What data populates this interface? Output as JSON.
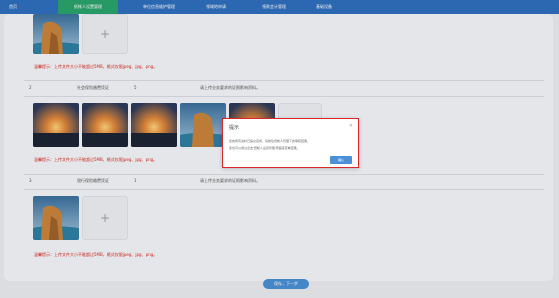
{
  "nav": {
    "items": [
      {
        "label": "首页",
        "active": false
      },
      {
        "label": "纸帐人设置管理",
        "active": true
      },
      {
        "label": "单位信息维护管理",
        "active": false
      },
      {
        "label": "领域地申请",
        "active": false
      },
      {
        "label": "领款会计管理",
        "active": false
      },
      {
        "label": "基础设备",
        "active": false
      }
    ]
  },
  "sections": [
    {
      "warning": "温馨提示：上传文件大小不能超过5MB，格式仅限jpeg、jpg、png。"
    },
    {
      "index": "2",
      "name": "社会保险缴费凭证",
      "count": "5",
      "description": "请上传业务要求的证照影响资料。",
      "warning": "温馨提示：上传文件大小不能超过5MB，格式仅限jpeg、jpg、png。"
    },
    {
      "index": "3",
      "name": "银行保险缴费凭证",
      "count": "1",
      "description": "请上传业务要求的证照影响资料。",
      "warning": "温馨提示：上传文件大小不能超过5MB，格式仅限jpeg、jpg、png。"
    }
  ],
  "upload_plus": "+",
  "dialog": {
    "title": "提示",
    "close": "×",
    "line1": "您的所有资料已提交完成，请前往纸帐人管理下的审核结果。",
    "line2": "您也可以通过点击'纸帐人设置管理'界面来查看结果。",
    "ok_label": "确认"
  },
  "next_button": "保存，下一步",
  "colors": {
    "nav": "#2f6fbe",
    "nav_active": "#2aa36b",
    "warning": "#d6281f",
    "primary": "#4a90d9",
    "dialog_border": "#d9292c"
  }
}
